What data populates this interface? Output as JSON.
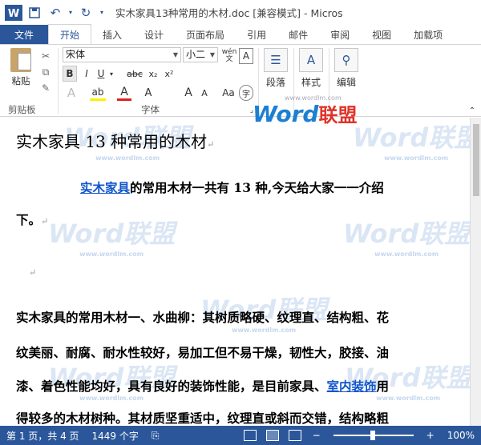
{
  "window": {
    "title": "实木家具13种常用的木材.doc [兼容模式] - Micros"
  },
  "tabs": [
    {
      "label": "文件"
    },
    {
      "label": "开始"
    },
    {
      "label": "插入"
    },
    {
      "label": "设计"
    },
    {
      "label": "页面布局"
    },
    {
      "label": "引用"
    },
    {
      "label": "邮件"
    },
    {
      "label": "审阅"
    },
    {
      "label": "视图"
    },
    {
      "label": "加载项"
    }
  ],
  "ribbon": {
    "paste_label": "粘贴",
    "clipboard_group": "剪贴板",
    "font_group": "字体",
    "font_name": "宋体",
    "font_size": "小二",
    "wen_label": "wén",
    "paragraph_label": "段落",
    "styles_label": "样式",
    "editing_label": "编辑"
  },
  "document": {
    "title": "实木家具 13 种常用的木材",
    "para1_link": "实木家具",
    "para1_text": "的常用木材一共有 13 种,今天给大家一一介绍",
    "para1_line2": "下。",
    "para2_line1": "实木家具的常用木材一、水曲柳：其树质略硬、纹理直、结构粗、花",
    "para2_line2": "纹美丽、耐腐、耐水性较好，易加工但不易干燥，韧性大，胶接、油",
    "para2_line3_pre": "漆、着色性能均好，具有良好的装饰性能，是目前家具、",
    "para2_line3_link": "室内装饰",
    "para2_line3_post": "用",
    "para2_line4": "得较多的木材树种。其材质坚重适中，纹理直或斜而交错，结构略粗"
  },
  "watermark": {
    "word": "Word联盟",
    "url": "www.wordlm.com"
  },
  "status": {
    "page": "第 1 页，共 4 页",
    "words": "1449 个字",
    "zoom": "100%"
  },
  "colors": {
    "accent": "#2b579a",
    "link": "#1155cc",
    "logo_blue": "#1d7fd1",
    "logo_red": "#e0342a"
  }
}
